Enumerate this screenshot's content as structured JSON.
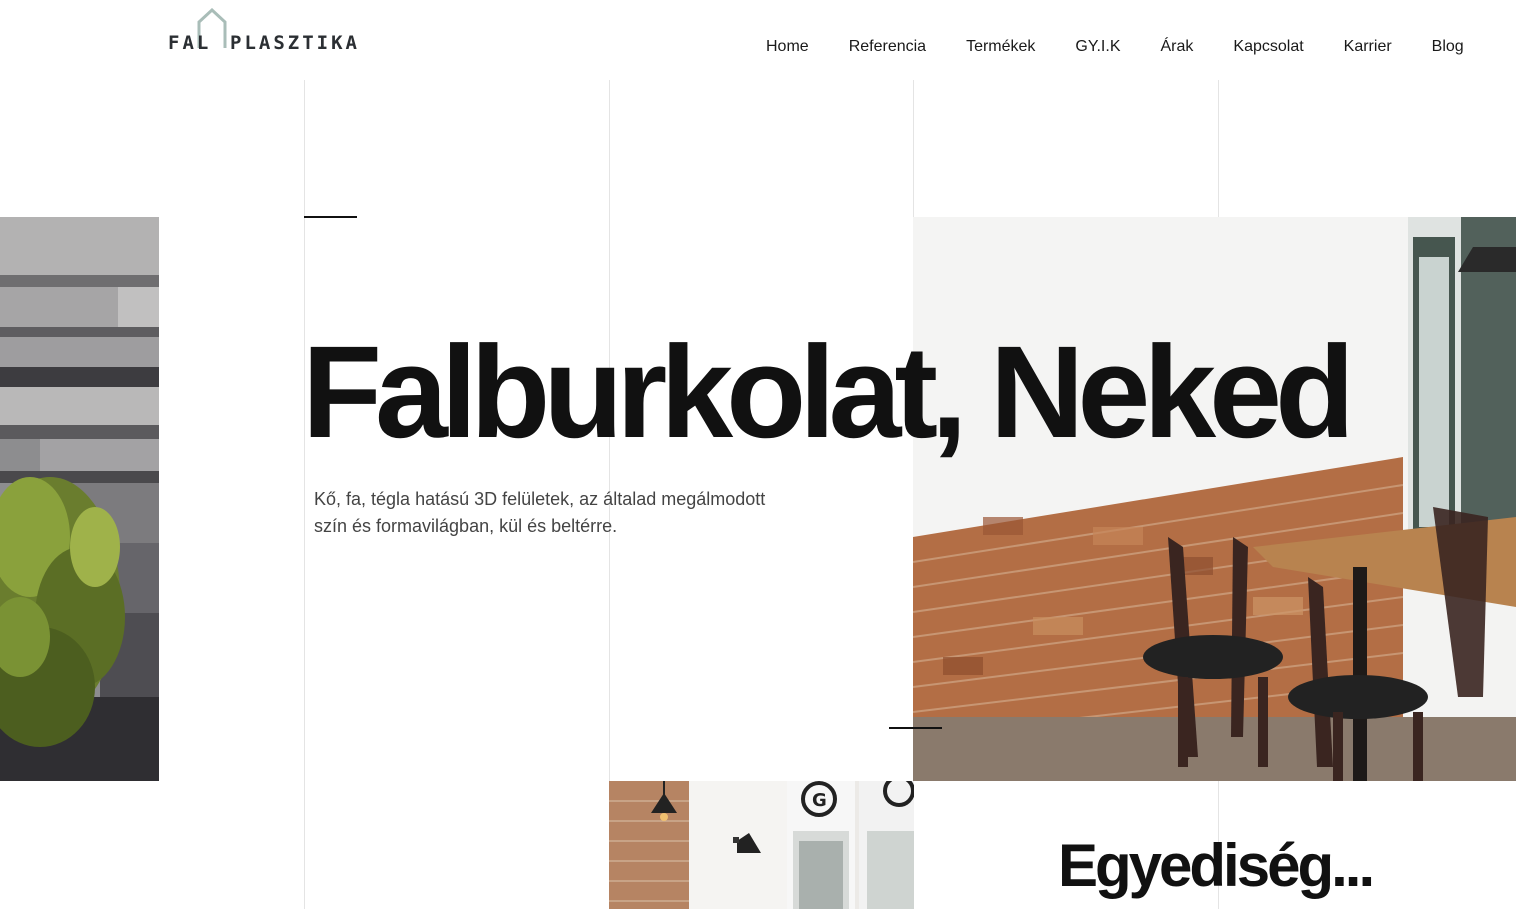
{
  "brand": {
    "logo_left": "FAL",
    "logo_right": "PLASZTIKA"
  },
  "nav": {
    "items": [
      {
        "label": "Home"
      },
      {
        "label": "Referencia"
      },
      {
        "label": "Termékek"
      },
      {
        "label": "GY.I.K"
      },
      {
        "label": "Árak"
      },
      {
        "label": "Kapcsolat"
      },
      {
        "label": "Karrier"
      },
      {
        "label": "Blog"
      }
    ]
  },
  "hero": {
    "title": "Falburkolat, Neked",
    "subtitle": "Kő, fa, tégla hatású 3D felületek, az általad megálmodott szín és formavilágban, kül és beltérre."
  },
  "section": {
    "title": "Egyediség..."
  },
  "images": {
    "left": "stone-wall-with-shrub-photo",
    "right": "brick-wall-cafe-interior-photo",
    "bottom": "cafe-interior-with-lamps-photo"
  },
  "colors": {
    "text": "#111111",
    "subtitle": "#444444",
    "guide_lines": "#e4e4e4",
    "logo": "#2b2f33",
    "logo_house": "#a9bdb8",
    "brick": "#b36e45"
  }
}
